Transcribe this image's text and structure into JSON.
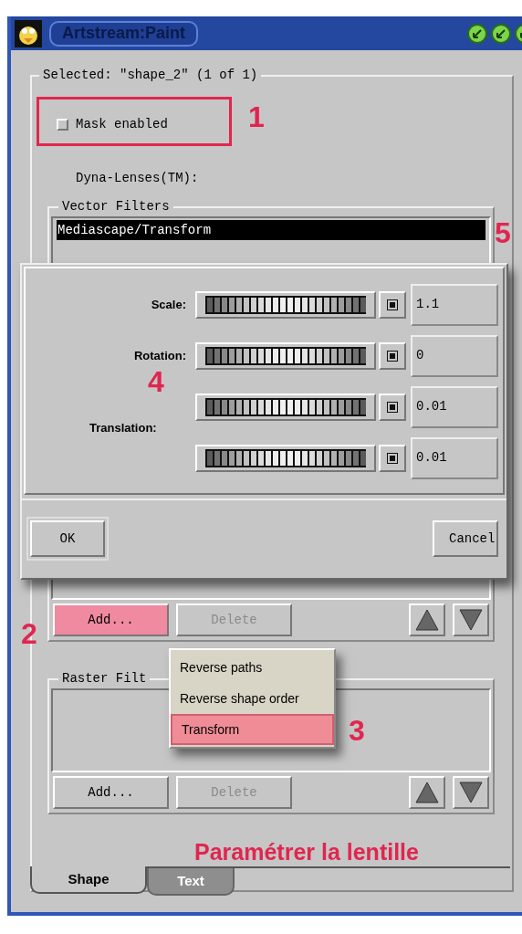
{
  "window": {
    "title": "Artstream:Paint"
  },
  "selection_group": {
    "title": "Selected: \"shape_2\" (1 of 1)"
  },
  "mask_checkbox": {
    "label": "Mask enabled",
    "checked": false
  },
  "lenses_label": "Dyna-Lenses(TM):",
  "vector_filters": {
    "title": "Vector Filters",
    "items": [
      {
        "label": "Mediascape/Transform",
        "selected": true
      }
    ],
    "buttons": [
      {
        "label": "Add...",
        "highlighted": true,
        "disabled": false
      },
      {
        "label": "Delete",
        "highlighted": false,
        "disabled": true
      }
    ]
  },
  "raster_filters": {
    "title": "Raster Filt",
    "buttons": [
      {
        "label": "Add...",
        "highlighted": false,
        "disabled": false
      },
      {
        "label": "Delete",
        "highlighted": false,
        "disabled": true
      }
    ]
  },
  "dialog": {
    "rows": [
      {
        "label": "Scale:",
        "value": "1.1"
      },
      {
        "label": "Rotation:",
        "value": "0"
      },
      {
        "value": "0.01"
      },
      {
        "value": "0.01"
      }
    ],
    "group_label": "Translation:",
    "buttons": [
      "OK",
      "Cancel"
    ]
  },
  "menu": {
    "items": [
      {
        "label": "Reverse paths",
        "selected": false
      },
      {
        "label": "Reverse shape order",
        "selected": false
      },
      {
        "label": "Transform",
        "selected": true
      }
    ]
  },
  "tabs": [
    {
      "label": "Shape",
      "selected": true
    },
    {
      "label": "Text",
      "selected": false
    }
  ],
  "annotations": {
    "markers": [
      "1",
      "5",
      "4",
      "2",
      "3"
    ],
    "caption": "Paramétrer la lentille"
  }
}
